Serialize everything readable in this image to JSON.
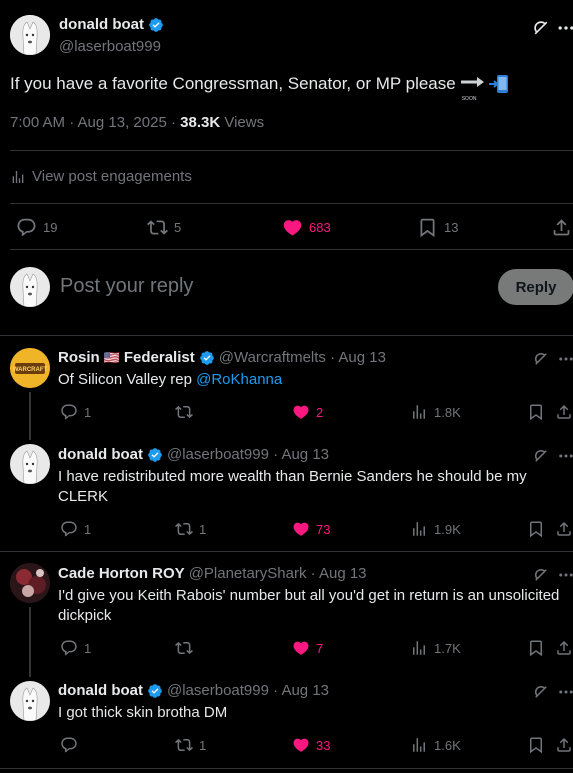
{
  "main_post": {
    "author_name": "donald boat",
    "author_handle": "@laserboat999",
    "text": "If you have a favorite Congressman, Senator, or MP please",
    "emoji_soon": "SOON",
    "time": "7:00 AM · Aug 13, 2025",
    "separator": " · ",
    "views_count": "38.3K",
    "views_label": " Views",
    "engagements_label": "View post engagements",
    "replies": "19",
    "reposts": "5",
    "likes": "683",
    "bookmarks": "13"
  },
  "composer": {
    "placeholder": "Post your reply",
    "reply_button": "Reply"
  },
  "replies": [
    {
      "name": "Rosin",
      "flag": "🇺🇸",
      "name_suffix": "Federalist",
      "handle": "@Warcraftmelts · Aug 13",
      "text_prefix": "Of Silicon Valley rep ",
      "mention": "@RoKhanna",
      "replies": "1",
      "reposts": "",
      "likes": "2",
      "views": "1.8K",
      "avatar_text": "WARCRAFT"
    },
    {
      "name": "donald boat",
      "handle": "@laserboat999 · Aug 13",
      "text": "I have redistributed more wealth than Bernie Sanders he should be my CLERK",
      "replies": "1",
      "reposts": "1",
      "likes": "73",
      "views": "1.9K"
    },
    {
      "name": "Cade Horton ROY",
      "handle": "@PlanetaryShark · Aug 13",
      "text": "I'd give you Keith Rabois' number but all you'd get in return is an unsolicited dickpick",
      "replies": "1",
      "reposts": "",
      "likes": "7",
      "views": "1.7K"
    },
    {
      "name": "donald boat",
      "handle": "@laserboat999 · Aug 13",
      "text": "I got thick skin brotha DM",
      "replies": "",
      "reposts": "1",
      "likes": "33",
      "views": "1.6K"
    }
  ],
  "colors": {
    "background": "#000000",
    "like_pink": "#f91880",
    "verified_blue": "#1d9bf0",
    "muted": "#71767b"
  }
}
